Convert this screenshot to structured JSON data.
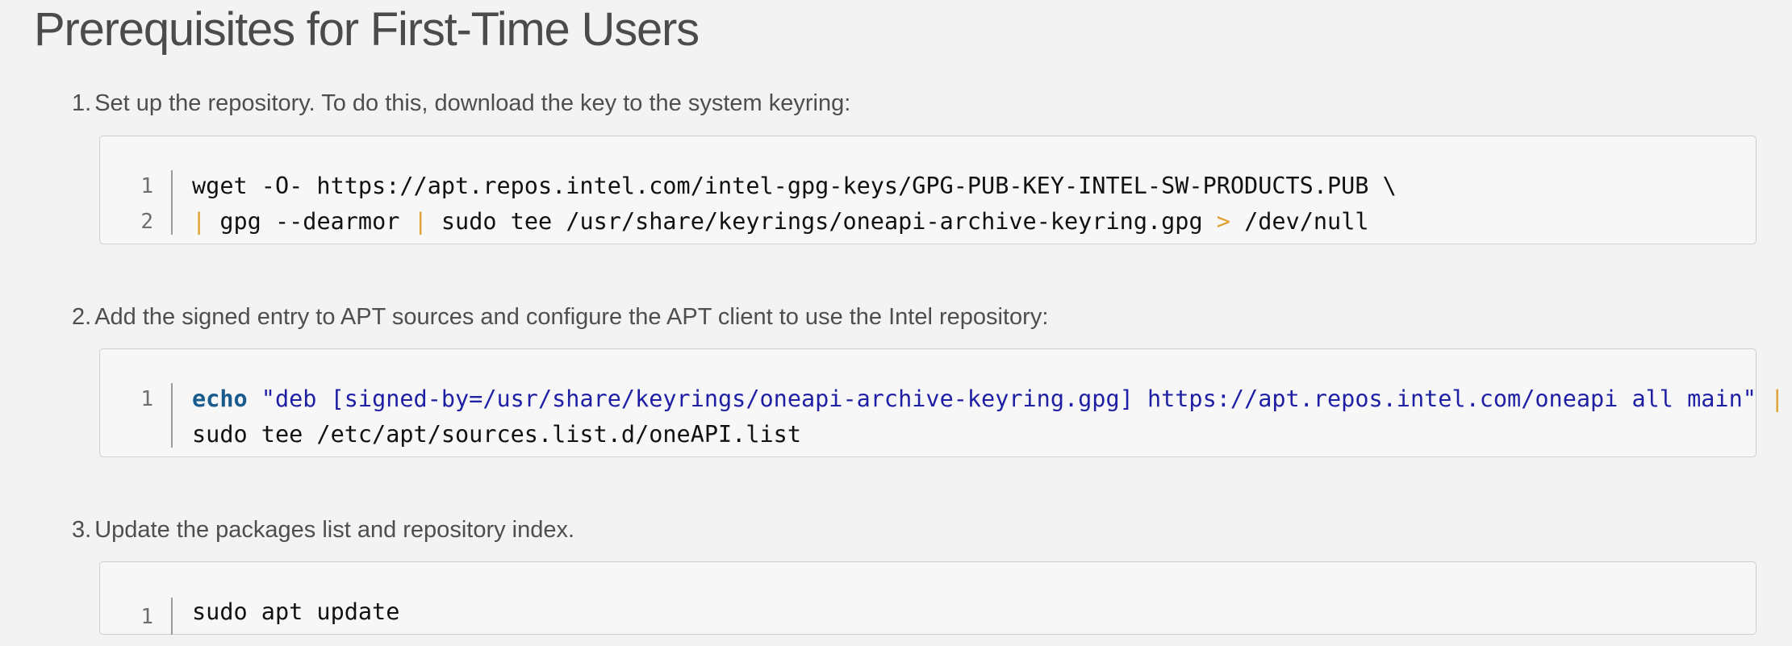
{
  "page_title": "Prerequisites for First-Time Users",
  "steps": [
    {
      "number": "1.",
      "text": "Set up the repository. To do this, download the key to the system keyring:",
      "lines": [
        {
          "num": "1",
          "code": "wget -O- https://apt.repos.intel.com/intel-gpg-keys/GPG-PUB-KEY-INTEL-SW-PRODUCTS.PUB \\"
        },
        {
          "num": "2",
          "pipe1": "|",
          "part1": " gpg --dearmor ",
          "pipe2": "|",
          "part2": " sudo tee /usr/share/keyrings/oneapi-archive-keyring.gpg ",
          "redirect": ">",
          "part3": " /dev/null"
        }
      ]
    },
    {
      "number": "2.",
      "text": "Add the signed entry to APT sources and configure the APT client to use the Intel repository:",
      "lines": [
        {
          "num": "1",
          "keyword": "echo",
          "string": " \"deb [signed-by=/usr/share/keyrings/oneapi-archive-keyring.gpg] https://apt.repos.intel.com/oneapi all main\" ",
          "pipe": "|",
          "continuation": "sudo tee /etc/apt/sources.list.d/oneAPI.list"
        }
      ]
    },
    {
      "number": "3.",
      "text": "Update the packages list and repository index.",
      "lines": [
        {
          "num": "1",
          "code": "sudo apt update"
        }
      ]
    }
  ],
  "colors": {
    "background": "#f3f3f3",
    "code_background": "#f7f7f7",
    "operator": "#e0a030",
    "keyword": "#1a5b8e",
    "string": "#1f1fa6"
  }
}
